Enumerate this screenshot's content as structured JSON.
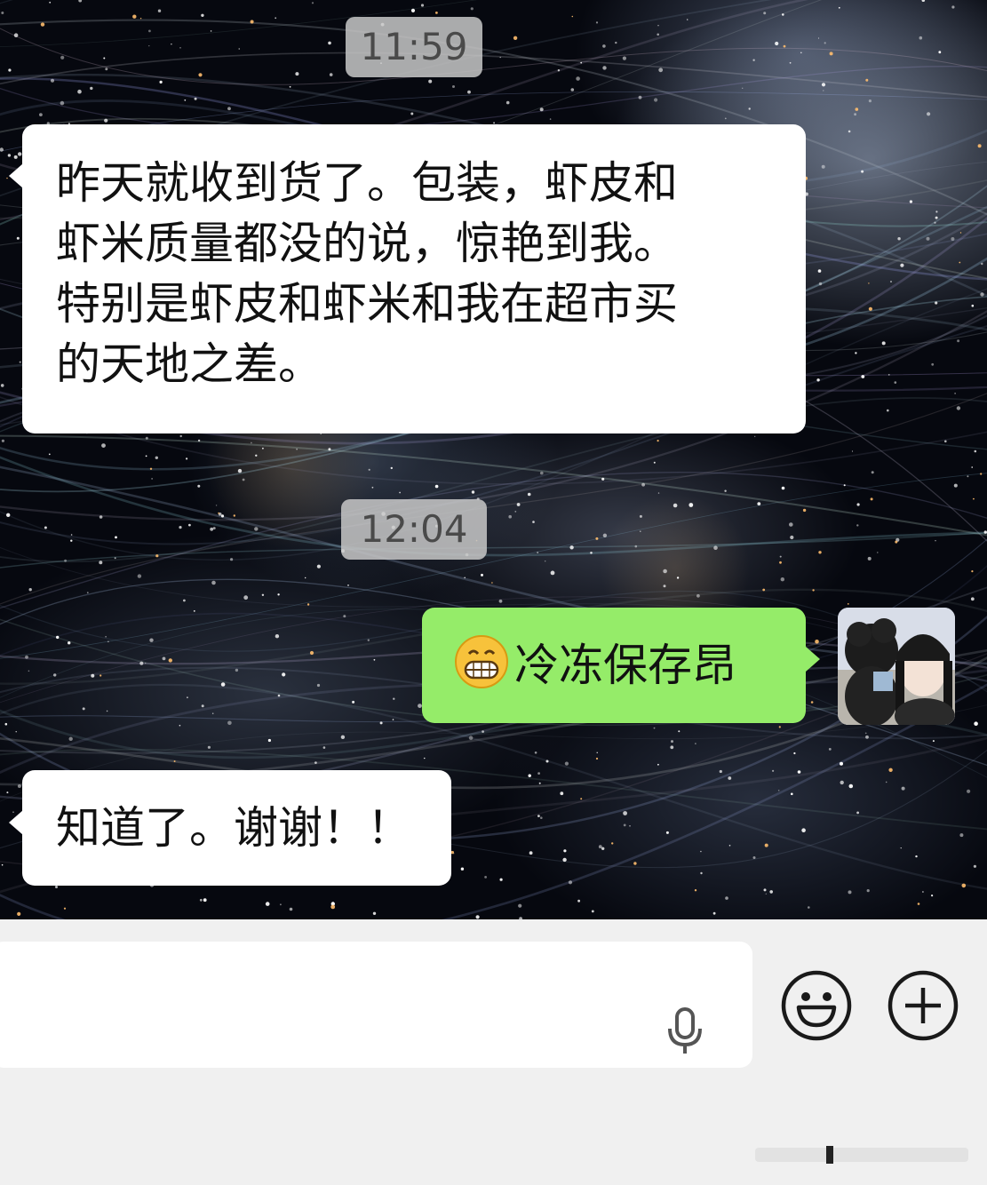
{
  "messages": [
    {
      "type": "time",
      "text": "11:59"
    },
    {
      "type": "incoming",
      "lines": [
        "昨天就收到货了。包装，虾皮和",
        "虾米质量都没的说，惊艳到我。",
        "特别是虾皮和虾米和我在超市买",
        "的天地之差。"
      ]
    },
    {
      "type": "time",
      "text": "12:04"
    },
    {
      "type": "outgoing",
      "emoji": "grinning-face-icon",
      "text": "冷冻保存昂"
    },
    {
      "type": "incoming",
      "lines": [
        "知道了。谢谢！！"
      ]
    }
  ],
  "input_bar": {
    "voice_icon": "microphone-icon",
    "emoji_icon": "smiley-icon",
    "more_icon": "plus-circle-icon"
  },
  "colors": {
    "incoming_bubble": "#ffffff",
    "outgoing_bubble": "#95ec69",
    "time_pill": "#c8c8c8",
    "input_bar_bg": "#f0f0f0",
    "icon_stroke": "#1a1a1a"
  }
}
